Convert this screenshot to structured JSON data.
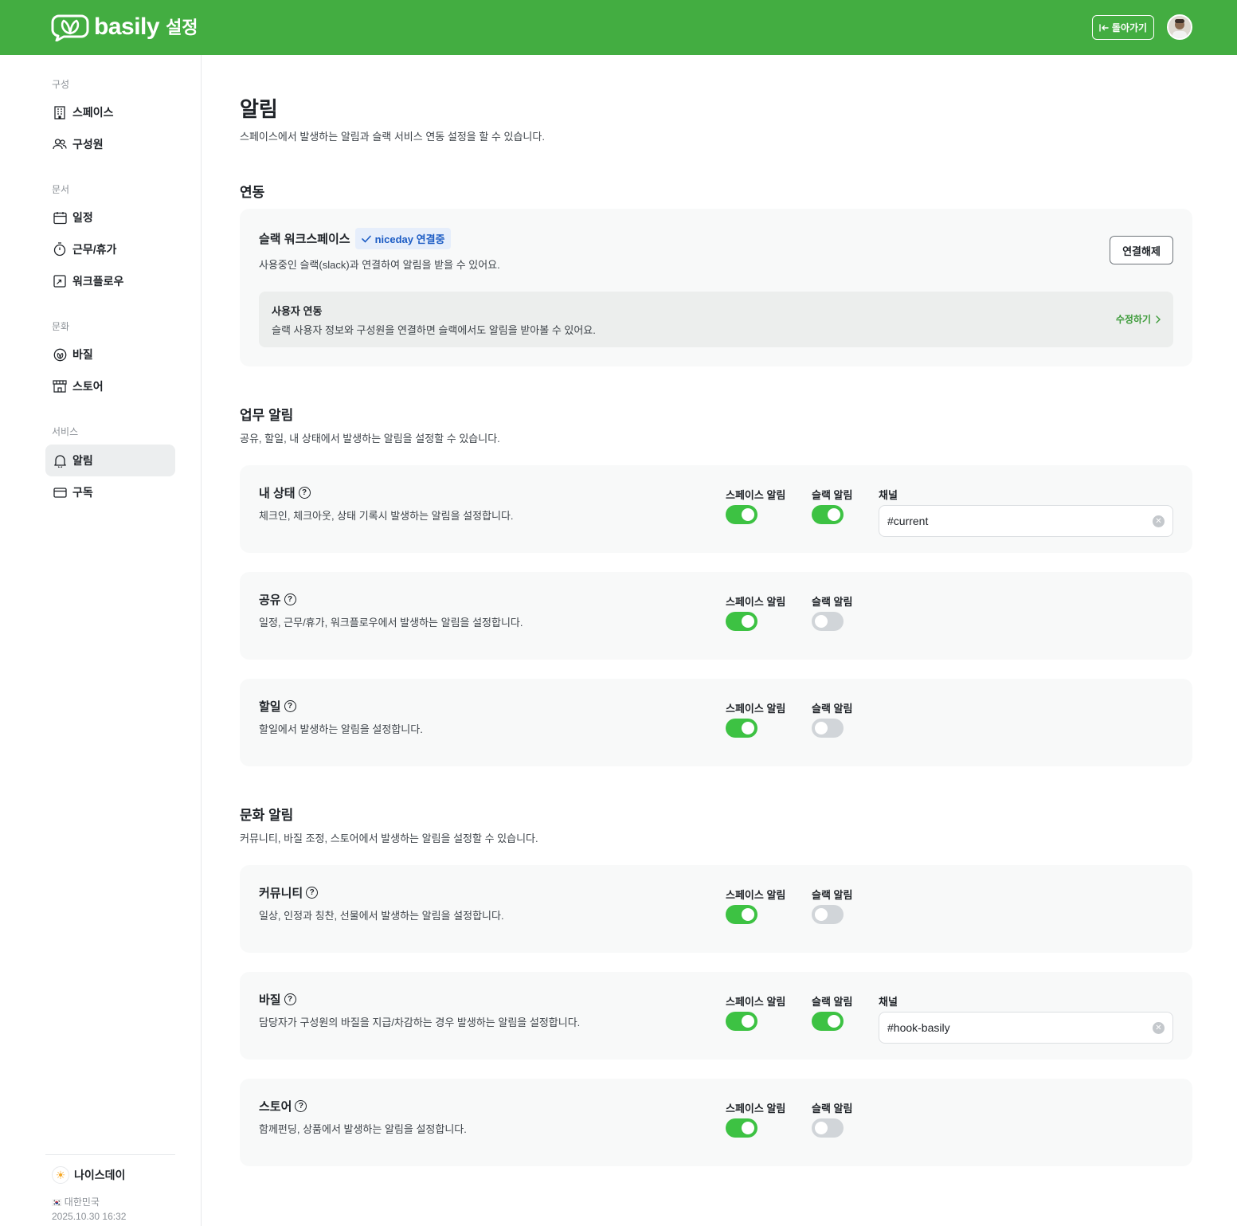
{
  "header": {
    "brand": "basily",
    "subtitle": "설정",
    "back_label": "돌아가기",
    "color": "#43ad41"
  },
  "sidebar": {
    "sections": [
      {
        "label": "구성",
        "items": [
          {
            "label": "스페이스",
            "icon": "building-icon"
          },
          {
            "label": "구성원",
            "icon": "users-icon"
          }
        ]
      },
      {
        "label": "문서",
        "items": [
          {
            "label": "일정",
            "icon": "calendar-icon"
          },
          {
            "label": "근무/휴가",
            "icon": "timer-icon"
          },
          {
            "label": "워크플로우",
            "icon": "workflow-icon"
          }
        ]
      },
      {
        "label": "문화",
        "items": [
          {
            "label": "바질",
            "icon": "basil-icon"
          },
          {
            "label": "스토어",
            "icon": "store-icon"
          }
        ]
      },
      {
        "label": "서비스",
        "items": [
          {
            "label": "알림",
            "icon": "bell-icon",
            "active": true
          },
          {
            "label": "구독",
            "icon": "card-icon"
          }
        ]
      }
    ],
    "org_name": "나이스데이",
    "country": "대한민국",
    "datetime": "2025.10.30 16:32"
  },
  "page": {
    "title": "알림",
    "desc": "스페이스에서 발생하는 알림과 슬랙 서비스 연동 설정을 할 수 있습니다."
  },
  "integration": {
    "title": "연동",
    "slack_title": "슬랙 워크스페이스",
    "badge": "niceday 연결중",
    "slack_desc": "사용중인 슬랙(slack)과 연결하여 알림을 받을 수 있어요.",
    "disconnect_label": "연결해제",
    "user_link_title": "사용자 연동",
    "user_link_desc": "슬랙 사용자 정보와 구성원을 연결하면 슬랙에서도 알림을 받아볼 수 있어요.",
    "edit_label": "수정하기"
  },
  "labels": {
    "space": "스페이스 알림",
    "slack": "슬랙 알림",
    "channel": "채널"
  },
  "work": {
    "title": "업무 알림",
    "desc": "공유, 할일, 내 상태에서 발생하는 알림을 설정할 수 있습니다.",
    "items": [
      {
        "title": "내 상태",
        "desc": "체크인, 체크아웃, 상태 기록시 발생하는 알림을 설정합니다.",
        "space": true,
        "slack": true,
        "channel": "#current"
      },
      {
        "title": "공유",
        "desc": "일정, 근무/휴가, 워크플로우에서 발생하는 알림을 설정합니다.",
        "space": true,
        "slack": false
      },
      {
        "title": "할일",
        "desc": "할일에서 발생하는 알림을 설정합니다.",
        "space": true,
        "slack": false
      }
    ]
  },
  "culture": {
    "title": "문화 알림",
    "desc": "커뮤니티, 바질 조정, 스토어에서 발생하는 알림을 설정할 수 있습니다.",
    "items": [
      {
        "title": "커뮤니티",
        "desc": "일상, 인정과 칭찬, 선물에서 발생하는 알림을 설정합니다.",
        "space": true,
        "slack": false
      },
      {
        "title": "바질",
        "desc": "담당자가 구성원의 바질을 지급/차감하는 경우 발생하는 알림을 설정합니다.",
        "space": true,
        "slack": true,
        "channel": "#hook-basily"
      },
      {
        "title": "스토어",
        "desc": "함께펀딩, 상품에서 발생하는 알림을 설정합니다.",
        "space": true,
        "slack": false
      }
    ]
  }
}
